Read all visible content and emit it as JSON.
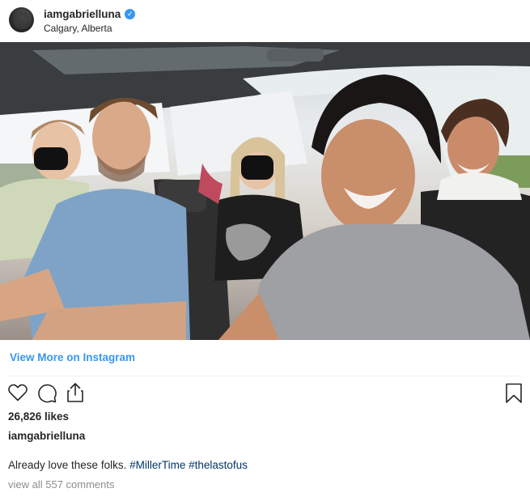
{
  "header": {
    "username": "iamgabrielluna",
    "verified_icon": "verified-badge-icon",
    "location": "Calgary, Alberta"
  },
  "photo": {
    "description_icon": "photo"
  },
  "link": {
    "view_more": "View More on Instagram"
  },
  "actions": {
    "like_icon": "heart-icon",
    "comment_icon": "comment-icon",
    "share_icon": "share-icon",
    "save_icon": "bookmark-icon"
  },
  "stats": {
    "likes": "26,826 likes"
  },
  "caption": {
    "username": "iamgabrielluna",
    "text": "Already love these folks.",
    "hashtags": [
      "#MillerTime",
      "#thelastofus"
    ]
  },
  "comments": {
    "view_all": "view all 557 comments"
  },
  "colors": {
    "link_blue": "#3897f0",
    "hashtag": "#003569",
    "muted": "#8e8e8e",
    "text": "#262626"
  }
}
